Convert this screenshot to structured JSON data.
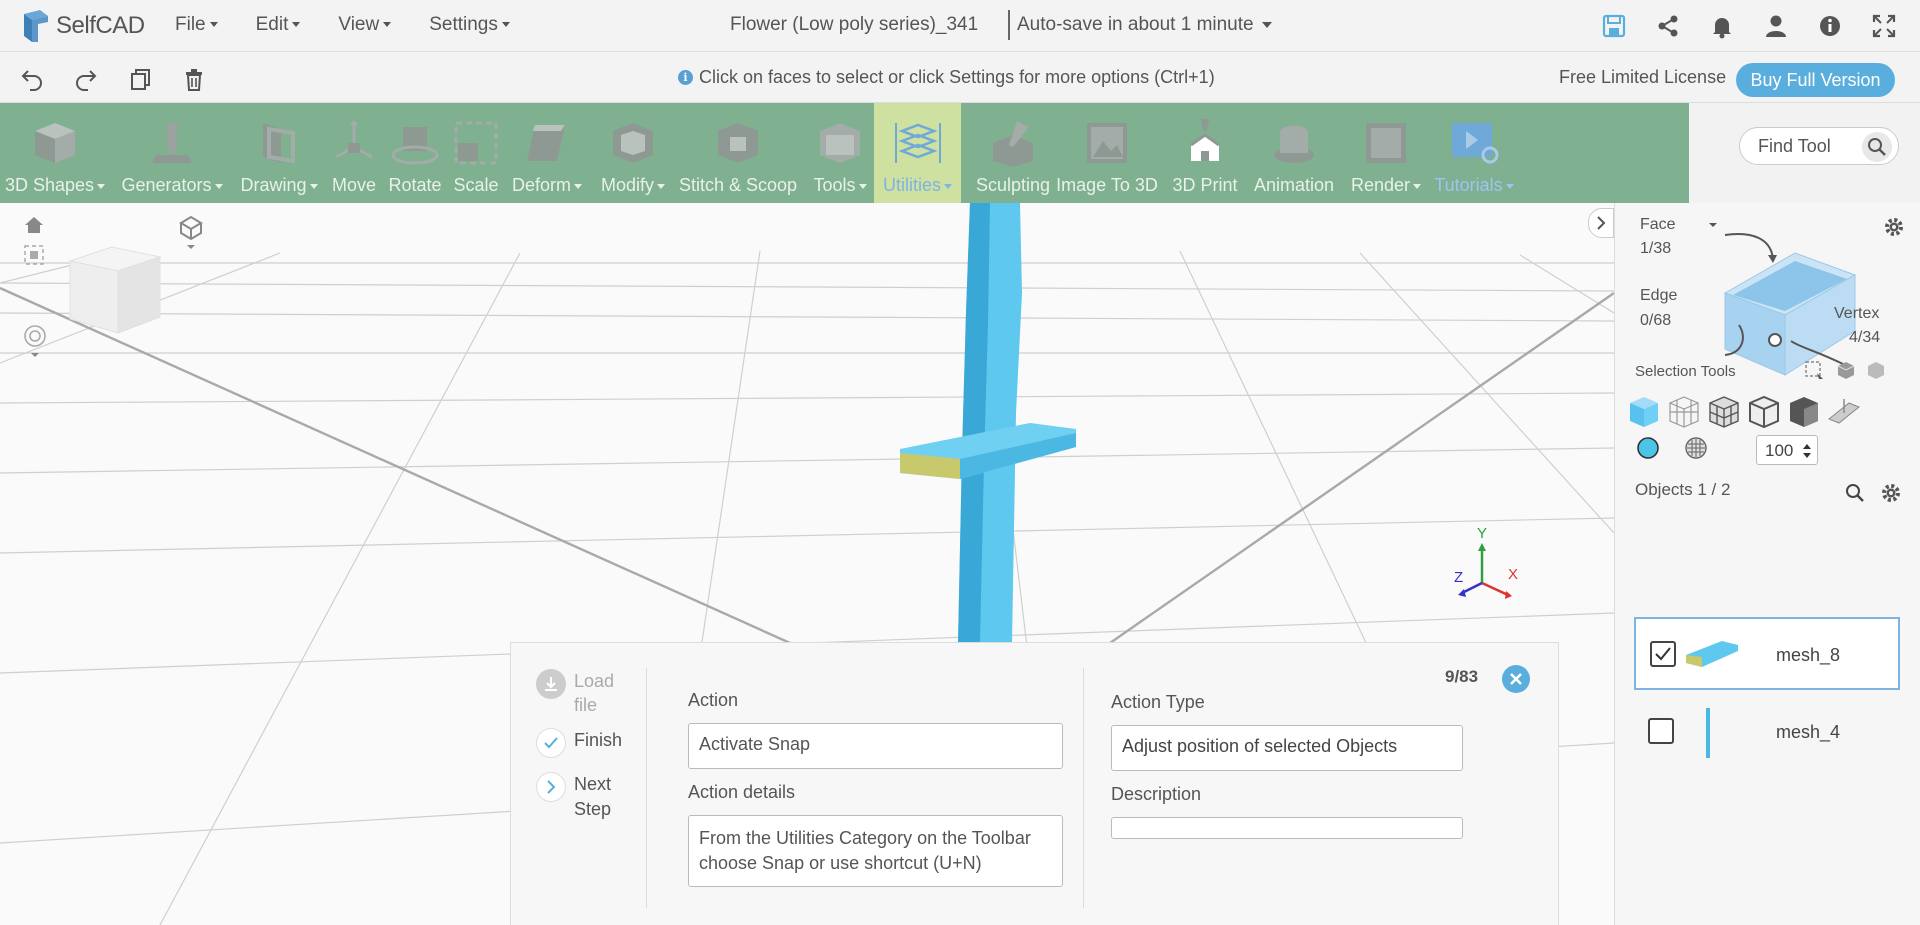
{
  "app": {
    "name": "SelfCAD"
  },
  "menu": [
    "File",
    "Edit",
    "View",
    "Settings"
  ],
  "project": {
    "title": "Flower (Low poly series)_341",
    "autosave": "Auto-save in about 1 minute"
  },
  "hint": "Click on faces to select or click Settings for more options (Ctrl+1)",
  "license": {
    "text": "Free Limited License",
    "buy_label": "Buy Full Version"
  },
  "toolbar": {
    "tools": [
      {
        "label": "3D Shapes",
        "icon": "cube-icon"
      },
      {
        "label": "Generators",
        "icon": "generator-icon"
      },
      {
        "label": "Drawing",
        "icon": "drawing-icon"
      },
      {
        "label": "Move",
        "icon": "move-icon"
      },
      {
        "label": "Rotate",
        "icon": "rotate-icon"
      },
      {
        "label": "Scale",
        "icon": "scale-icon"
      },
      {
        "label": "Deform",
        "icon": "deform-icon"
      },
      {
        "label": "Modify",
        "icon": "modify-icon"
      },
      {
        "label": "Stitch & Scoop",
        "icon": "stitch-icon"
      },
      {
        "label": "Tools",
        "icon": "tools-icon"
      },
      {
        "label": "Utilities",
        "icon": "utilities-icon",
        "active": true
      },
      {
        "label": "Sculpting",
        "icon": "sculpting-icon"
      },
      {
        "label": "Image To 3D",
        "icon": "image-icon"
      },
      {
        "label": "3D Print",
        "icon": "print-icon"
      },
      {
        "label": "Animation",
        "icon": "animation-icon"
      },
      {
        "label": "Render",
        "icon": "render-icon"
      },
      {
        "label": "Tutorials",
        "icon": "tutorials-icon"
      }
    ],
    "find_placeholder": "Find Tool"
  },
  "selection": {
    "face_label": "Face",
    "face_count": "1/38",
    "edge_label": "Edge",
    "edge_count": "0/68",
    "vertex_label": "Vertex",
    "vertex_count": "4/34",
    "tools_label": "Selection Tools",
    "opacity_value": "100"
  },
  "objects": {
    "label": "Objects 1 / 2",
    "items": [
      {
        "name": "mesh_8",
        "checked": true
      },
      {
        "name": "mesh_4",
        "checked": false
      }
    ]
  },
  "axes": {
    "y": "Y",
    "x": "X",
    "z": "Z"
  },
  "tutorial": {
    "counter": "9/83",
    "steps": [
      {
        "label": "Load file",
        "icon": "download-icon"
      },
      {
        "label": "Finish",
        "icon": "check-icon"
      },
      {
        "label": "Next Step",
        "icon": "chevron-right-icon"
      }
    ],
    "action_label": "Action",
    "action_value": "Activate Snap",
    "details_label": "Action details",
    "details_value": "From the Utilities Category on the Toolbar choose Snap or use shortcut (U+N)",
    "type_label": "Action Type",
    "type_value": "Adjust position of selected Objects",
    "description_label": "Description",
    "description_value": ""
  },
  "colors": {
    "accent": "#5aaedd",
    "toolbar": "#7fb08f",
    "active_tool": "#cfe1a0",
    "mesh": "#5ec8ee"
  }
}
